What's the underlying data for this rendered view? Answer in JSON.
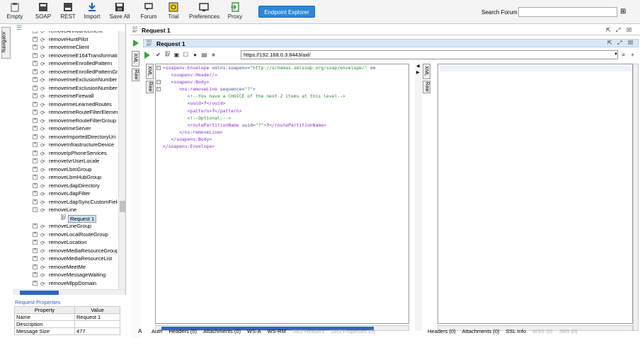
{
  "toolbar": {
    "buttons": [
      {
        "label": "Empty",
        "icon": "empty-project-icon"
      },
      {
        "label": "SOAP",
        "icon": "soap-project-icon"
      },
      {
        "label": "REST",
        "icon": "rest-project-icon"
      },
      {
        "label": "Import",
        "icon": "import-icon"
      },
      {
        "label": "Save All",
        "icon": "save-all-icon"
      },
      {
        "label": "Forum",
        "icon": "forum-icon"
      },
      {
        "label": "Trial",
        "icon": "trial-icon"
      },
      {
        "label": "Preferences",
        "icon": "preferences-icon"
      },
      {
        "label": "Proxy",
        "icon": "proxy-icon"
      }
    ],
    "endpoint_explorer": "Endpoint Explorer",
    "search_label": "Search Forum",
    "search_value": ""
  },
  "navigator": {
    "tab_label": "Navigator",
    "tree": [
      {
        "name": "removeAnnouncement",
        "expanded": false
      },
      {
        "name": "removeHuntPilot",
        "expanded": false
      },
      {
        "name": "removeImeClient",
        "expanded": false
      },
      {
        "name": "removeImeE164Transformation",
        "expanded": false
      },
      {
        "name": "removeImeEnrolledPattern",
        "expanded": false
      },
      {
        "name": "removeImeEnrolledPatternGroup",
        "expanded": false
      },
      {
        "name": "removeImeExclusionNumber",
        "expanded": false
      },
      {
        "name": "removeImeExclusionNumberGroup",
        "expanded": false
      },
      {
        "name": "removeImeFirewall",
        "expanded": false
      },
      {
        "name": "removeImeLearnedRoutes",
        "expanded": false
      },
      {
        "name": "removeImeRouteFilterElement",
        "expanded": false
      },
      {
        "name": "removeImeRouteFilterGroup",
        "expanded": false
      },
      {
        "name": "removeImeServer",
        "expanded": false
      },
      {
        "name": "removeImportedDirectoryUri",
        "expanded": false
      },
      {
        "name": "removeInfrastructureDevice",
        "expanded": false
      },
      {
        "name": "removeIpPhoneServices",
        "expanded": false
      },
      {
        "name": "removeIvrUserLocale",
        "expanded": false
      },
      {
        "name": "removeLbmGroup",
        "expanded": false
      },
      {
        "name": "removeLbmHubGroup",
        "expanded": false
      },
      {
        "name": "removeLdapDirectory",
        "expanded": false
      },
      {
        "name": "removeLdapFilter",
        "expanded": false
      },
      {
        "name": "removeLdapSyncCustomField",
        "expanded": false
      },
      {
        "name": "removeLine",
        "expanded": true
      },
      {
        "name": "Request 1",
        "child": true
      },
      {
        "name": "removeLineGroup",
        "expanded": false
      },
      {
        "name": "removeLocalRouteGroup",
        "expanded": false
      },
      {
        "name": "removeLocation",
        "expanded": false
      },
      {
        "name": "removeMediaResourceGroup",
        "expanded": false
      },
      {
        "name": "removeMediaResourceList",
        "expanded": false
      },
      {
        "name": "removeMeetMe",
        "expanded": false
      },
      {
        "name": "removeMessageWaiting",
        "expanded": false
      },
      {
        "name": "removeMlppDomain",
        "expanded": false
      }
    ]
  },
  "request_properties": {
    "title": "Request Properties",
    "col_property": "Property",
    "col_value": "Value",
    "rows": [
      {
        "property": "Name",
        "value": "Request 1"
      },
      {
        "property": "Description",
        "value": ""
      },
      {
        "property": "Message Size",
        "value": "477"
      }
    ]
  },
  "editor": {
    "outer_title": "Request 1",
    "inner_title": "Request 1",
    "url": "https://192.168.0.3:8443/axl/",
    "xml_tab": "XML",
    "raw_tab": "Raw",
    "lines": [
      {
        "parts": [
          [
            "tag",
            "<soapenv:Envelope "
          ],
          [
            "attr",
            "xmlns:soapenv="
          ],
          [
            "str",
            "\"http://schemas.xmlsoap.org/soap/envelope/\""
          ],
          [
            "attr",
            " xm"
          ]
        ]
      },
      {
        "parts": [
          [
            "tag",
            "   <soapenv:Header/>"
          ]
        ]
      },
      {
        "parts": [
          [
            "tag",
            "   <soapenv:Body>"
          ]
        ]
      },
      {
        "parts": [
          [
            "tag",
            "      <ns:removeLine "
          ],
          [
            "attr",
            "sequence="
          ],
          [
            "str",
            "\"?\""
          ],
          [
            "tag",
            ">"
          ]
        ]
      },
      {
        "parts": [
          [
            "cmt",
            "         <!--You have a CHOICE of the next 2 items at this level-->"
          ]
        ]
      },
      {
        "parts": [
          [
            "tag",
            "         <uuid>"
          ],
          [
            "txt",
            "?"
          ],
          [
            "tag",
            "</uuid>"
          ]
        ]
      },
      {
        "parts": [
          [
            "tag",
            "         <pattern>"
          ],
          [
            "txt",
            "?"
          ],
          [
            "tag",
            "</pattern>"
          ]
        ]
      },
      {
        "parts": [
          [
            "cmt",
            "         <!--Optional:-->"
          ]
        ]
      },
      {
        "parts": [
          [
            "tag",
            "         <routePartitionName "
          ],
          [
            "attr",
            "uuid="
          ],
          [
            "str",
            "\"?\""
          ],
          [
            "tag",
            ">"
          ],
          [
            "txt",
            "?"
          ],
          [
            "tag",
            "</routePartitionName>"
          ]
        ]
      },
      {
        "parts": [
          [
            "tag",
            "      </ns:removeLine>"
          ]
        ]
      },
      {
        "parts": [
          [
            "tag",
            "   </soapenv:Body>"
          ]
        ]
      },
      {
        "parts": [
          [
            "tag",
            "</soapenv:Envelope>"
          ]
        ]
      }
    ],
    "request_tabs": [
      {
        "label": "Auth",
        "disabled": false
      },
      {
        "label": "Headers (0)",
        "disabled": false
      },
      {
        "label": "Attachments (0)",
        "disabled": false
      },
      {
        "label": "WS-A",
        "disabled": false
      },
      {
        "label": "WS-RM",
        "disabled": false
      },
      {
        "label": "JMS Headers",
        "disabled": true
      },
      {
        "label": "JMS Properties (0)",
        "disabled": true
      }
    ],
    "response_tabs": [
      {
        "label": "Headers (0)",
        "disabled": false
      },
      {
        "label": "Attachments (0)",
        "disabled": false
      },
      {
        "label": "SSL Info",
        "disabled": false
      },
      {
        "label": "WSS (0)",
        "disabled": true
      },
      {
        "label": "JMS (0)",
        "disabled": true
      }
    ],
    "side_letter": "A"
  },
  "colors": {
    "accent": "#2e86d4",
    "run_green": "#2cab2c",
    "selection": "#cfe3f7"
  }
}
